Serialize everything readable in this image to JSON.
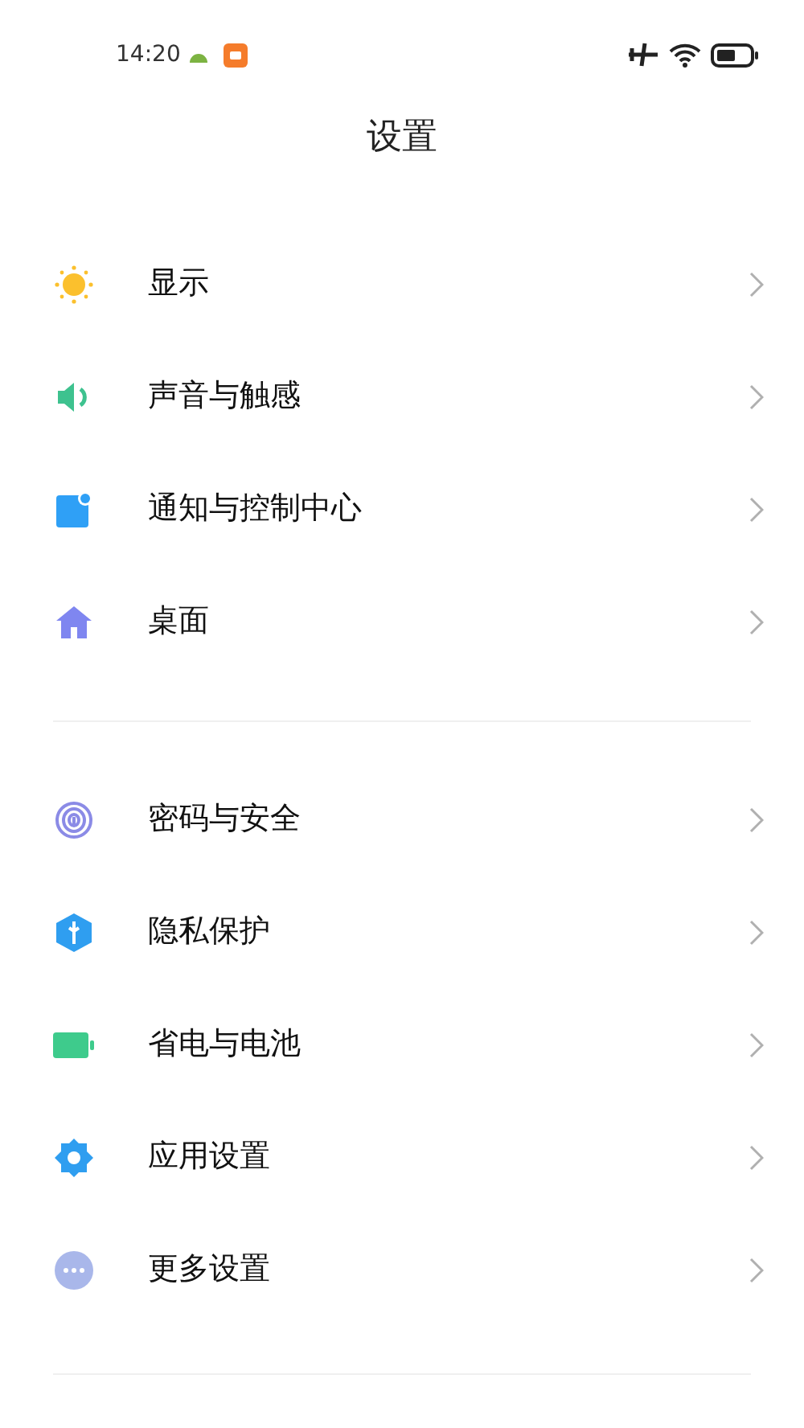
{
  "status_bar": {
    "time": "14:20"
  },
  "title": "设置",
  "groups": [
    {
      "items": [
        {
          "label": "显示"
        },
        {
          "label": "声音与触感"
        },
        {
          "label": "通知与控制中心"
        },
        {
          "label": "桌面"
        }
      ]
    },
    {
      "items": [
        {
          "label": "密码与安全"
        },
        {
          "label": "隐私保护"
        },
        {
          "label": "省电与电池"
        },
        {
          "label": "应用设置"
        },
        {
          "label": "更多设置"
        }
      ]
    }
  ]
}
